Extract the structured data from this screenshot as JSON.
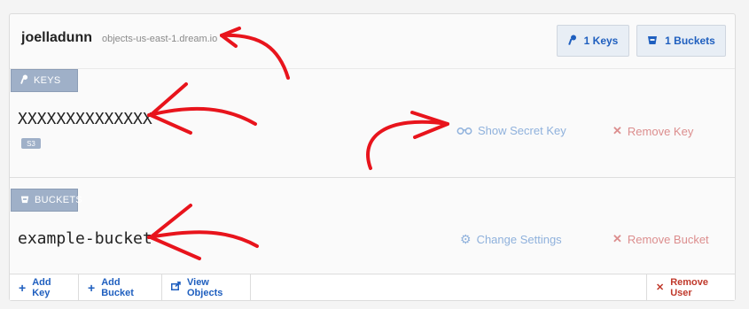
{
  "header": {
    "username": "joelladunn",
    "host": "objects-us-east-1.dream.io"
  },
  "topbar": {
    "keys_label": "1 Keys",
    "buckets_label": "1 Buckets"
  },
  "keys_section": {
    "tag": "KEYS",
    "key_value": "XXXXXXXXXXXXXX",
    "badge": "S3",
    "show_secret": "Show Secret Key",
    "remove_key": "Remove Key"
  },
  "buckets_section": {
    "tag": "BUCKETS",
    "bucket_name": "example-bucket",
    "change_settings": "Change Settings",
    "remove_bucket": "Remove Bucket"
  },
  "footer": {
    "add_key": "Add Key",
    "add_bucket": "Add Bucket",
    "view_objects": "View Objects",
    "remove_user": "Remove User"
  },
  "colors": {
    "accent": "#1f5fbf",
    "danger": "#c0392b",
    "tag": "#9fb0c8",
    "annotation": "#e8141c"
  },
  "icons": [
    "key-icon",
    "bucket-icon",
    "glasses-icon",
    "x-icon",
    "gear-icon",
    "plus-icon",
    "export-icon"
  ]
}
